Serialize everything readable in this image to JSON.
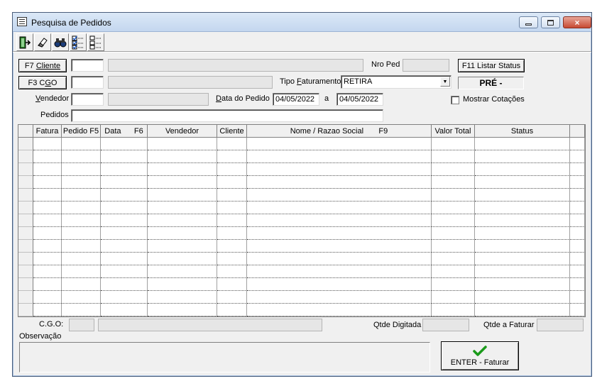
{
  "window": {
    "title": "Pesquisa de Pedidos",
    "close_glyph": "×"
  },
  "toolbar": {
    "icons": [
      "exit-door-icon",
      "eraser-icon",
      "binoculars-icon",
      "checklist-icon",
      "unchecked-list-icon"
    ]
  },
  "form": {
    "cliente_btn_prefix": "F7 ",
    "cliente_btn_label": "Cliente",
    "cliente_code": "",
    "cliente_name": "",
    "nro_ped_label": "Nro Ped",
    "nro_ped_value": "",
    "listar_status_btn": "F11 Listar Status",
    "cgo_btn_prefix": "F3 C",
    "cgo_btn_underline": "G",
    "cgo_btn_suffix": "O",
    "cgo_code": "",
    "cgo_name": "",
    "tipo_fat_label_a": "Tipo ",
    "tipo_fat_label_u": "F",
    "tipo_fat_label_b": "aturamento",
    "tipo_fat_value": "RETIRA",
    "status_box": "PRÉ -",
    "vendedor_label_u": "V",
    "vendedor_label_b": "endedor",
    "vendedor_code": "",
    "vendedor_name": "",
    "data_pedido_label_u": "D",
    "data_pedido_label_b": "ata do Pedido",
    "data_from": "04/05/2022",
    "date_sep": "a",
    "data_to": "04/05/2022",
    "mostrar_cotacoes": "Mostrar Cotações",
    "mostrar_cotacoes_checked": false,
    "pedidos_label": "Pedidos",
    "pedidos_value": ""
  },
  "grid": {
    "columns": [
      "",
      "Fatura",
      "Pedido F5",
      "Data      F6",
      "Vendedor",
      "Cliente",
      "Nome / Razao Social       F9",
      "Valor Total",
      "Status",
      ""
    ],
    "row_count": 14
  },
  "footer": {
    "cgo_label": "C.G.O:",
    "cgo_code": "",
    "cgo_name": "",
    "qtde_digitada_label": "Qtde Digitada",
    "qtde_digitada_value": "",
    "qtde_faturar_label": "Qtde a Faturar",
    "qtde_faturar_value": "",
    "observacao_label": "Observação",
    "observacao_value": "",
    "enter_btn_label": "ENTER - Faturar",
    "accent_green": "#1a9a1a"
  }
}
